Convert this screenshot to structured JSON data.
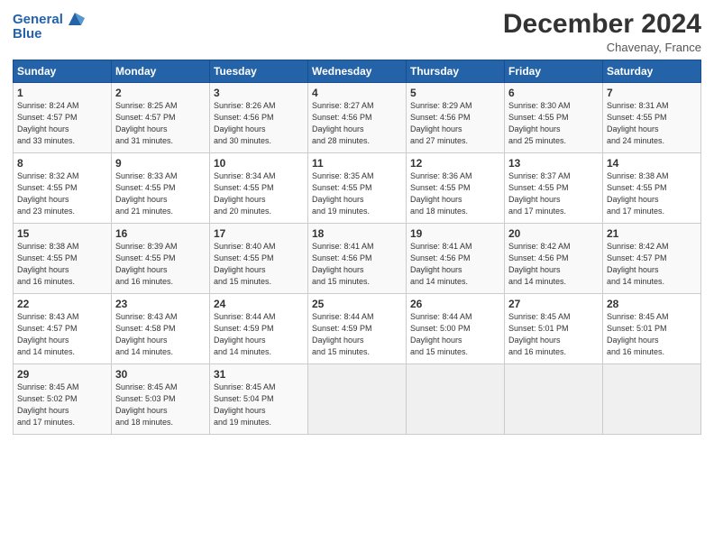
{
  "header": {
    "logo_line1": "General",
    "logo_line2": "Blue",
    "month_title": "December 2024",
    "location": "Chavenay, France"
  },
  "days_of_week": [
    "Sunday",
    "Monday",
    "Tuesday",
    "Wednesday",
    "Thursday",
    "Friday",
    "Saturday"
  ],
  "weeks": [
    [
      {
        "num": "1",
        "rise": "8:24 AM",
        "set": "4:57 PM",
        "hours": "8 hours and 33 minutes."
      },
      {
        "num": "2",
        "rise": "8:25 AM",
        "set": "4:57 PM",
        "hours": "8 hours and 31 minutes."
      },
      {
        "num": "3",
        "rise": "8:26 AM",
        "set": "4:56 PM",
        "hours": "8 hours and 30 minutes."
      },
      {
        "num": "4",
        "rise": "8:27 AM",
        "set": "4:56 PM",
        "hours": "8 hours and 28 minutes."
      },
      {
        "num": "5",
        "rise": "8:29 AM",
        "set": "4:56 PM",
        "hours": "8 hours and 27 minutes."
      },
      {
        "num": "6",
        "rise": "8:30 AM",
        "set": "4:55 PM",
        "hours": "8 hours and 25 minutes."
      },
      {
        "num": "7",
        "rise": "8:31 AM",
        "set": "4:55 PM",
        "hours": "8 hours and 24 minutes."
      }
    ],
    [
      {
        "num": "8",
        "rise": "8:32 AM",
        "set": "4:55 PM",
        "hours": "8 hours and 23 minutes."
      },
      {
        "num": "9",
        "rise": "8:33 AM",
        "set": "4:55 PM",
        "hours": "8 hours and 21 minutes."
      },
      {
        "num": "10",
        "rise": "8:34 AM",
        "set": "4:55 PM",
        "hours": "8 hours and 20 minutes."
      },
      {
        "num": "11",
        "rise": "8:35 AM",
        "set": "4:55 PM",
        "hours": "8 hours and 19 minutes."
      },
      {
        "num": "12",
        "rise": "8:36 AM",
        "set": "4:55 PM",
        "hours": "8 hours and 18 minutes."
      },
      {
        "num": "13",
        "rise": "8:37 AM",
        "set": "4:55 PM",
        "hours": "8 hours and 17 minutes."
      },
      {
        "num": "14",
        "rise": "8:38 AM",
        "set": "4:55 PM",
        "hours": "8 hours and 17 minutes."
      }
    ],
    [
      {
        "num": "15",
        "rise": "8:38 AM",
        "set": "4:55 PM",
        "hours": "8 hours and 16 minutes."
      },
      {
        "num": "16",
        "rise": "8:39 AM",
        "set": "4:55 PM",
        "hours": "8 hours and 16 minutes."
      },
      {
        "num": "17",
        "rise": "8:40 AM",
        "set": "4:55 PM",
        "hours": "8 hours and 15 minutes."
      },
      {
        "num": "18",
        "rise": "8:41 AM",
        "set": "4:56 PM",
        "hours": "8 hours and 15 minutes."
      },
      {
        "num": "19",
        "rise": "8:41 AM",
        "set": "4:56 PM",
        "hours": "8 hours and 14 minutes."
      },
      {
        "num": "20",
        "rise": "8:42 AM",
        "set": "4:56 PM",
        "hours": "8 hours and 14 minutes."
      },
      {
        "num": "21",
        "rise": "8:42 AM",
        "set": "4:57 PM",
        "hours": "8 hours and 14 minutes."
      }
    ],
    [
      {
        "num": "22",
        "rise": "8:43 AM",
        "set": "4:57 PM",
        "hours": "8 hours and 14 minutes."
      },
      {
        "num": "23",
        "rise": "8:43 AM",
        "set": "4:58 PM",
        "hours": "8 hours and 14 minutes."
      },
      {
        "num": "24",
        "rise": "8:44 AM",
        "set": "4:59 PM",
        "hours": "8 hours and 14 minutes."
      },
      {
        "num": "25",
        "rise": "8:44 AM",
        "set": "4:59 PM",
        "hours": "8 hours and 15 minutes."
      },
      {
        "num": "26",
        "rise": "8:44 AM",
        "set": "5:00 PM",
        "hours": "8 hours and 15 minutes."
      },
      {
        "num": "27",
        "rise": "8:45 AM",
        "set": "5:01 PM",
        "hours": "8 hours and 16 minutes."
      },
      {
        "num": "28",
        "rise": "8:45 AM",
        "set": "5:01 PM",
        "hours": "8 hours and 16 minutes."
      }
    ],
    [
      {
        "num": "29",
        "rise": "8:45 AM",
        "set": "5:02 PM",
        "hours": "8 hours and 17 minutes."
      },
      {
        "num": "30",
        "rise": "8:45 AM",
        "set": "5:03 PM",
        "hours": "8 hours and 18 minutes."
      },
      {
        "num": "31",
        "rise": "8:45 AM",
        "set": "5:04 PM",
        "hours": "8 hours and 19 minutes."
      },
      null,
      null,
      null,
      null
    ]
  ]
}
